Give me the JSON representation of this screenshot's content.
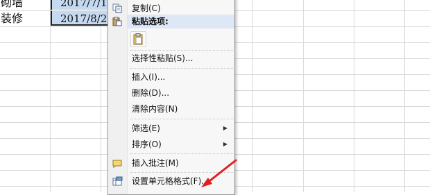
{
  "sheet": {
    "rows": [
      {
        "col_a": "砌墙",
        "col_b": "2017/7/1"
      },
      {
        "col_a": "装修",
        "col_b": "2017/8/2"
      }
    ]
  },
  "context_menu": {
    "copy": "复制(C)",
    "paste_options_header": "粘贴选项:",
    "paste_special": "选择性粘贴(S)...",
    "insert": "插入(I)...",
    "delete": "删除(D)...",
    "clear_contents": "清除内容(N)",
    "filter": "筛选(E)",
    "sort": "排序(O)",
    "insert_comment": "插入批注(M)",
    "format_cells": "设置单元格格式(F)..."
  },
  "icons": {
    "copy": "copy-icon",
    "paste": "paste-icon",
    "paste_button": "clipboard-icon",
    "insert_comment": "comment-icon",
    "format_cells": "format-cells-icon",
    "submenu": "chevron-right-icon"
  },
  "colors": {
    "selection": "#c5d9f1",
    "menu_header": "#dde7f5",
    "annotation_arrow": "#e02020"
  }
}
